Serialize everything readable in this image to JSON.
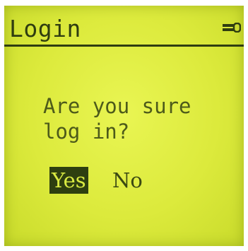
{
  "screen": {
    "title": "Login",
    "status_icon": "key-icon",
    "prompt_lines": [
      "Are you sure",
      "log in?"
    ],
    "options": [
      {
        "label": "Yes",
        "selected": true
      },
      {
        "label": "No",
        "selected": false
      }
    ]
  },
  "colors": {
    "lcd_background": "#dcea3c",
    "text_dark": "#2f3d10",
    "highlight_bg": "#2e3f10",
    "highlight_text": "#d9ea42"
  }
}
